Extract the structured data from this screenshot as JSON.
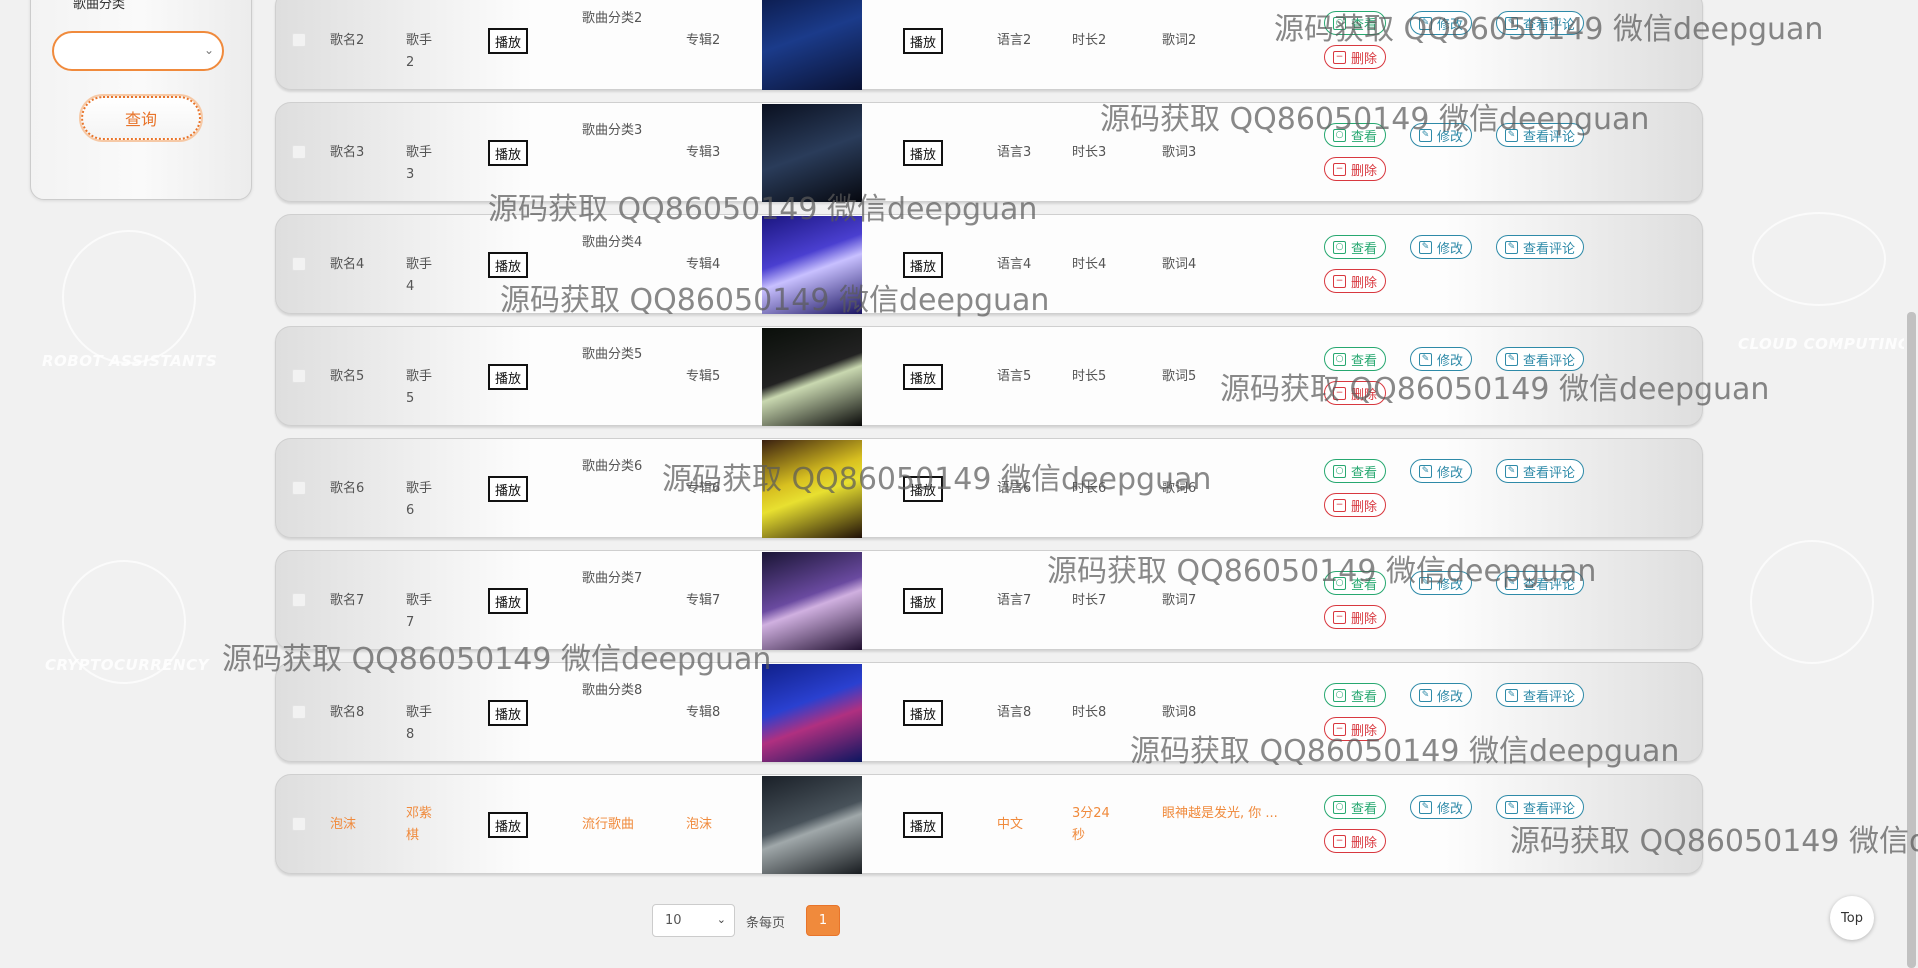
{
  "search": {
    "category_label": "歌曲分类",
    "category_value": "",
    "query_button": "查询"
  },
  "background": {
    "robot_label": "ROBOT ASSISTANTS",
    "crypto_label": "CRYPTOCURRENCY",
    "cloud_label": "CLOUD COMPUTING"
  },
  "buttons": {
    "play": "播放",
    "view": "查看",
    "edit": "修改",
    "comments": "查看评论",
    "delete": "删除"
  },
  "rows": [
    {
      "name": "歌名2",
      "singer": "歌手2",
      "category": "歌曲分类2",
      "album": "专辑2",
      "language": "语言2",
      "duration": "时长2",
      "lyrics": "歌词2",
      "highlight": false
    },
    {
      "name": "歌名3",
      "singer": "歌手3",
      "category": "歌曲分类3",
      "album": "专辑3",
      "language": "语言3",
      "duration": "时长3",
      "lyrics": "歌词3",
      "highlight": false
    },
    {
      "name": "歌名4",
      "singer": "歌手4",
      "category": "歌曲分类4",
      "album": "专辑4",
      "language": "语言4",
      "duration": "时长4",
      "lyrics": "歌词4",
      "highlight": false
    },
    {
      "name": "歌名5",
      "singer": "歌手5",
      "category": "歌曲分类5",
      "album": "专辑5",
      "language": "语言5",
      "duration": "时长5",
      "lyrics": "歌词5",
      "highlight": false
    },
    {
      "name": "歌名6",
      "singer": "歌手6",
      "category": "歌曲分类6",
      "album": "专辑6",
      "language": "语言6",
      "duration": "时长6",
      "lyrics": "歌词6",
      "highlight": false
    },
    {
      "name": "歌名7",
      "singer": "歌手7",
      "category": "歌曲分类7",
      "album": "专辑7",
      "language": "语言7",
      "duration": "时长7",
      "lyrics": "歌词7",
      "highlight": false
    },
    {
      "name": "歌名8",
      "singer": "歌手8",
      "category": "歌曲分类8",
      "album": "专辑8",
      "language": "语言8",
      "duration": "时长8",
      "lyrics": "歌词8",
      "highlight": false
    },
    {
      "name": "泡沫",
      "singer": "邓紫棋",
      "category": "流行歌曲",
      "album": "泡沫",
      "language": "中文",
      "duration": "3分24秒",
      "lyrics": "眼神越是发光, 你 ...",
      "highlight": true
    }
  ],
  "pagination": {
    "page_size": "10",
    "per_page_label": "条每页",
    "current_page": "1"
  },
  "top_button": "Top",
  "watermark": "源码获取 QQ86050149 微信deepguan",
  "colors": {
    "accent": "#f08a3c",
    "view_green": "#27a870",
    "edit_blue": "#2e8aa8",
    "delete_red": "#d8383f"
  }
}
